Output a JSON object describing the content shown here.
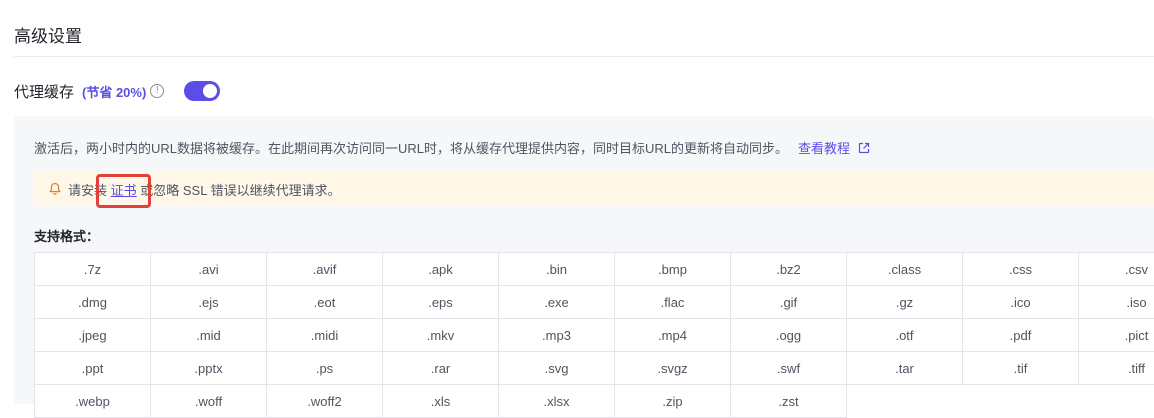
{
  "section": {
    "title": "高级设置"
  },
  "proxy_cache": {
    "label": "代理缓存",
    "saving": "(节省 20%)",
    "info_symbol": "!",
    "enabled": true
  },
  "panel": {
    "description": "激活后，两小时内的URL数据将被缓存。在此期间再次访问同一URL时，将从缓存代理提供内容，同时目标URL的更新将自动同步。",
    "tutorial_link": "查看教程",
    "warning": {
      "prefix": "请安装 ",
      "cert_link": "证书",
      "suffix": " 或忽略 SSL 错误以继续代理请求。"
    },
    "formats_label": "支持格式："
  },
  "formats": [
    ".7z",
    ".avi",
    ".avif",
    ".apk",
    ".bin",
    ".bmp",
    ".bz2",
    ".class",
    ".css",
    ".csv",
    ".dmg",
    ".ejs",
    ".eot",
    ".eps",
    ".exe",
    ".flac",
    ".gif",
    ".gz",
    ".ico",
    ".iso",
    ".jpeg",
    ".mid",
    ".midi",
    ".mkv",
    ".mp3",
    ".mp4",
    ".ogg",
    ".otf",
    ".pdf",
    ".pict",
    ".ppt",
    ".pptx",
    ".ps",
    ".rar",
    ".svg",
    ".svgz",
    ".swf",
    ".tar",
    ".tif",
    ".tiff",
    ".webp",
    ".woff",
    ".woff2",
    ".xls",
    ".xlsx",
    ".zip",
    ".zst"
  ],
  "colors": {
    "accent": "#5b4ee8",
    "warning_bg": "#fff7e8",
    "highlight_border": "#e0413a"
  }
}
